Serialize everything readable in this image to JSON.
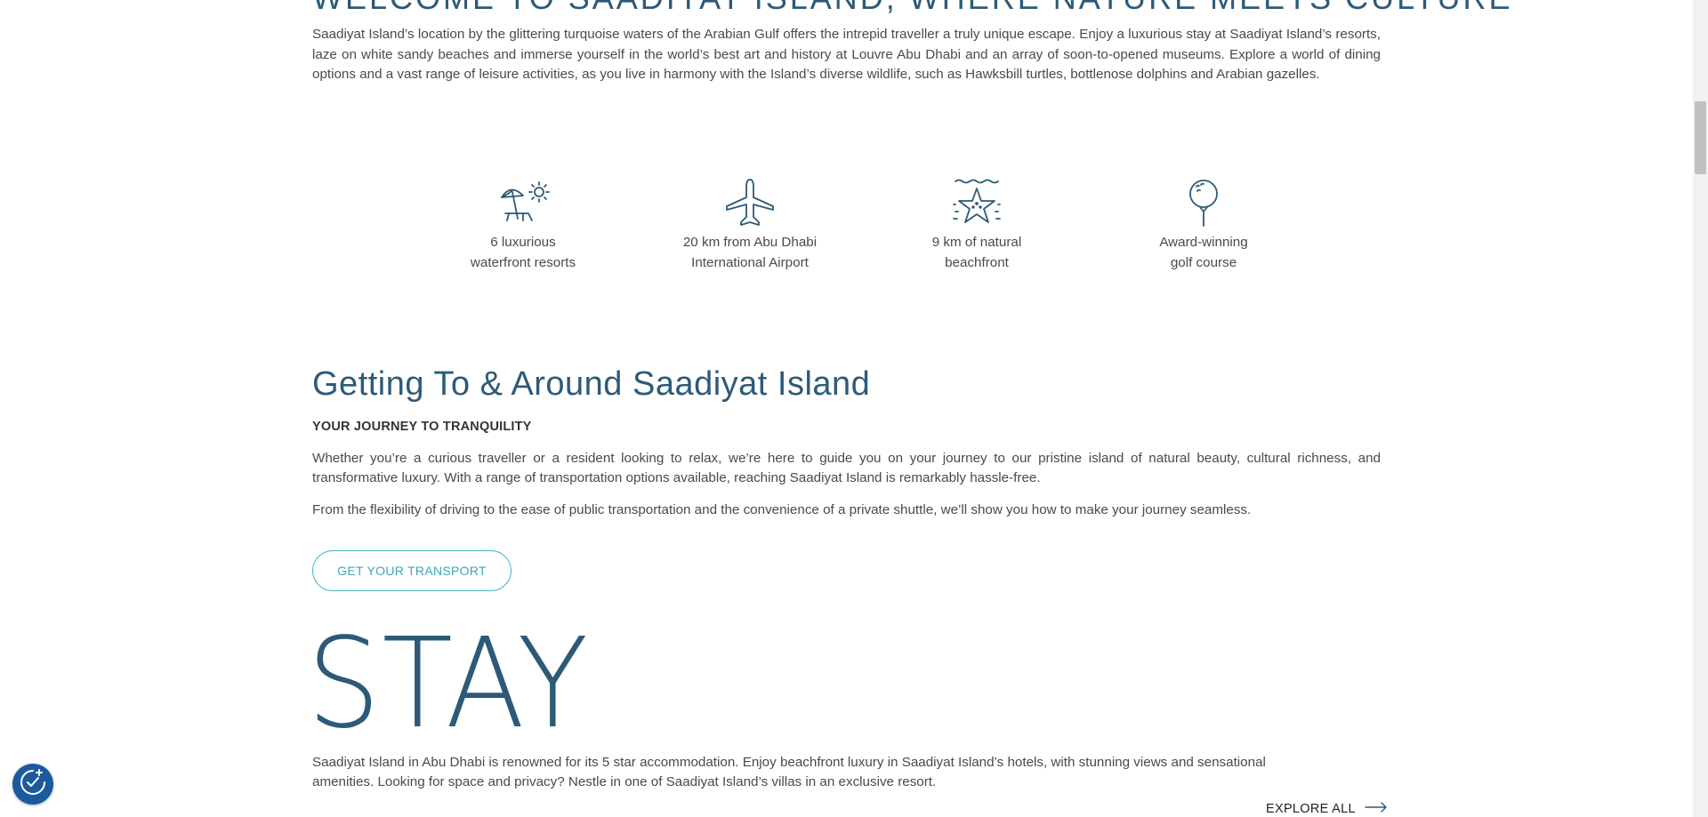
{
  "welcome": {
    "heading": "WELCOME TO SAADIYAT ISLAND, WHERE NATURE MEETS CULTURE",
    "intro": "Saadiyat Island’s location by the glittering turquoise waters of the Arabian Gulf offers the intrepid traveller a truly unique escape. Enjoy a luxurious stay at Saadiyat Island’s resorts, laze on white sandy beaches and immerse yourself in the world’s best art and history at Louvre Abu Dhabi and an array of soon-to-opened museums. Explore a world of dining options and a vast range of leisure activities, as you live in harmony with the Island’s diverse wildlife, such as Hawksbill turtles, bottlenose dolphins and Arabian gazelles."
  },
  "features": [
    {
      "icon": "beach-umbrella-icon",
      "label": "6 luxurious\nwaterfront resorts"
    },
    {
      "icon": "airplane-icon",
      "label": "20 km from Abu Dhabi\nInternational Airport"
    },
    {
      "icon": "starfish-icon",
      "label": "9 km of natural\nbeachfront"
    },
    {
      "icon": "golf-ball-icon",
      "label": "Award-winning\ngolf course"
    }
  ],
  "getting_around": {
    "title": "Getting To & Around Saadiyat Island",
    "subtitle": "YOUR JOURNEY TO TRANQUILITY",
    "paragraph1": "Whether you’re a curious traveller or a resident looking to relax, we’re here to guide you on your journey to our pristine island of natural beauty, cultural richness, and transformative luxury. With a range of transportation options available, reaching Saadiyat Island is remarkably hassle-free.",
    "paragraph2": "From the flexibility of driving to the ease of public transportation and the convenience of a private shuttle, we’ll show you how to make your journey seamless.",
    "button_label": "GET YOUR TRANSPORT"
  },
  "stay": {
    "heading": "STAY",
    "text": "Saadiyat Island in Abu Dhabi is renowned for its 5 star accommodation. Enjoy beachfront luxury in Saadiyat Island’s hotels, with stunning views and sensational amenities. Looking for space and privacy? Nestle in one of Saadiyat Island’s villas in an exclusive resort.",
    "explore_label": "EXPLORE ALL"
  },
  "colors": {
    "heading": "#2d5a78",
    "accent": "#4bb6c6",
    "body_text": "#4a4a4a",
    "accessibility_button": "#1c5a9e"
  }
}
